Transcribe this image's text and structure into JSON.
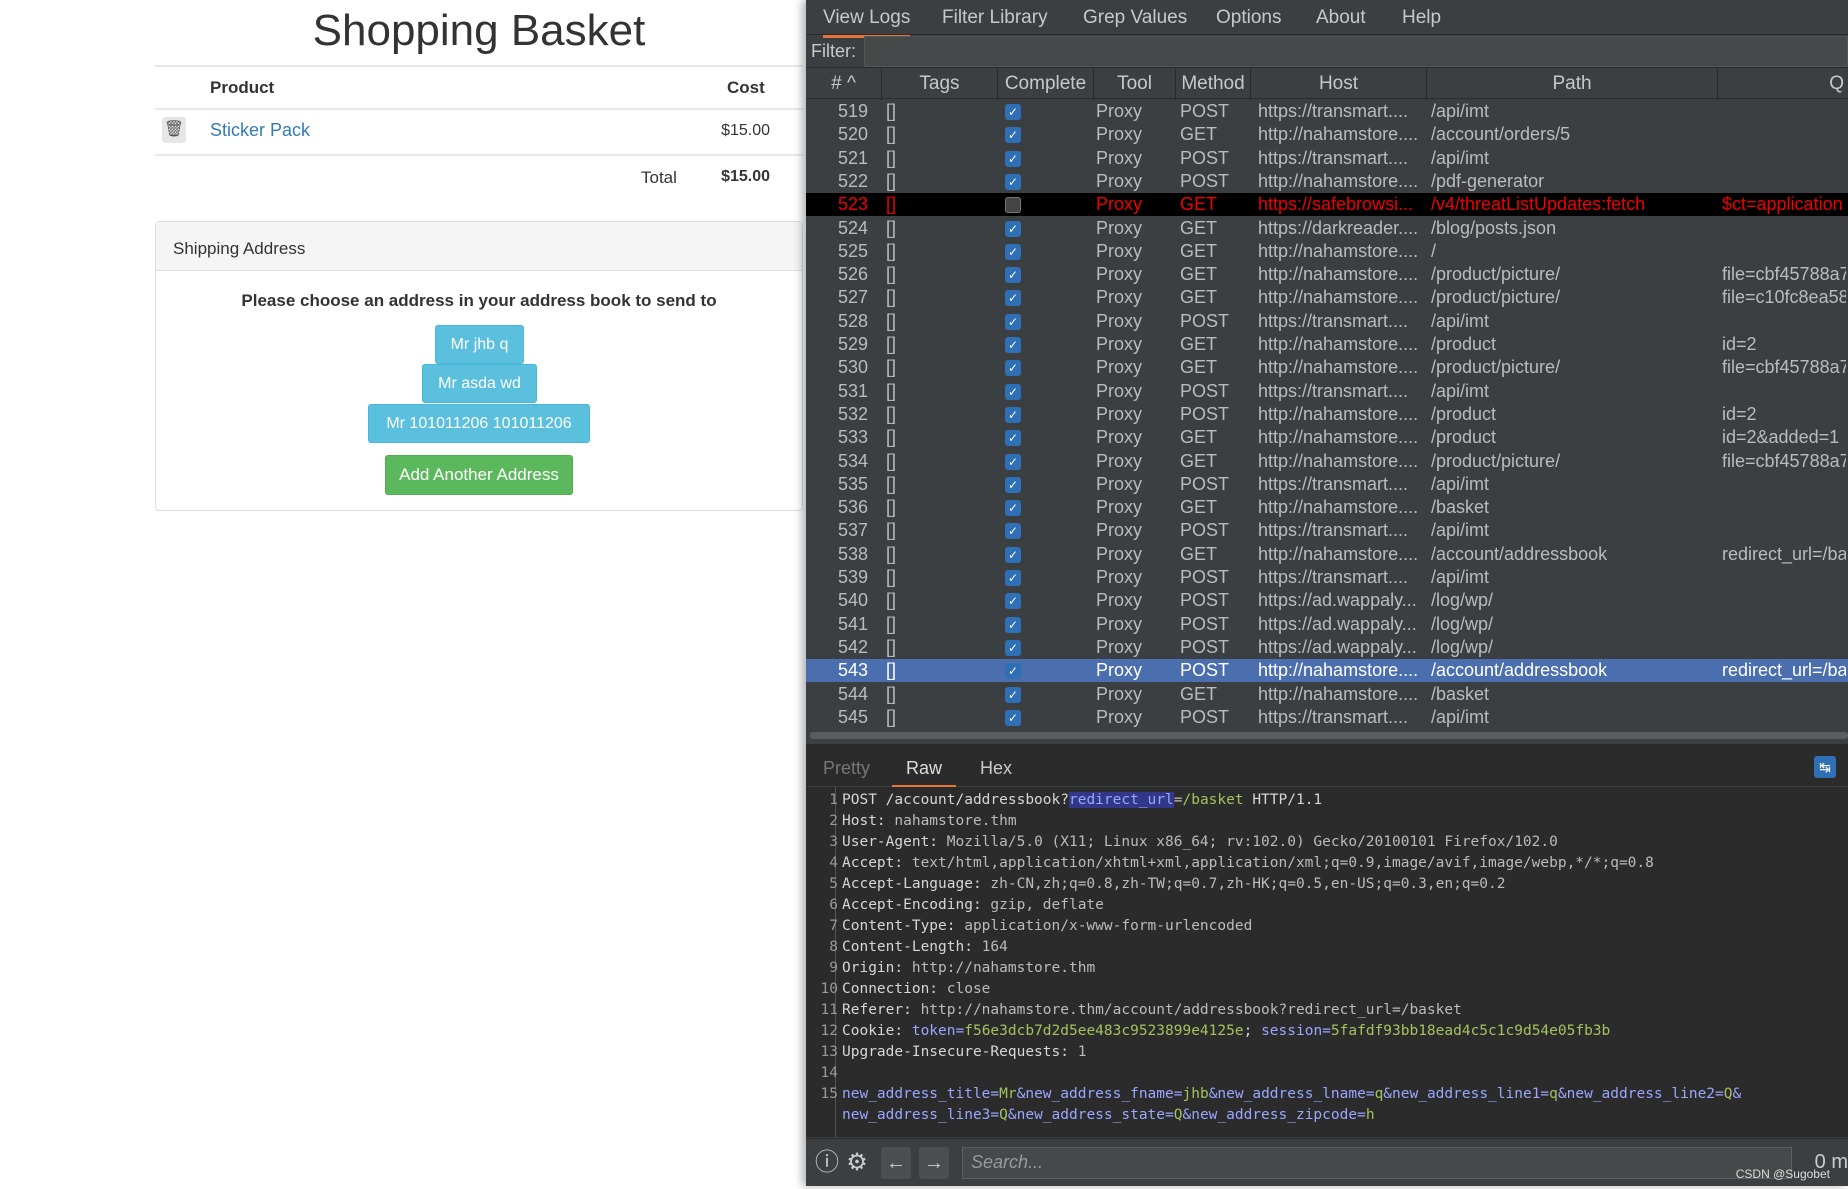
{
  "shop": {
    "title": "Shopping Basket",
    "col_product": "Product",
    "col_cost": "Cost",
    "item": {
      "name": "Sticker Pack",
      "cost": "$15.00"
    },
    "total_label": "Total",
    "total_value": "$15.00",
    "shipping": {
      "header": "Shipping Address",
      "message": "Please choose an address in your address book to send to",
      "addresses": [
        "Mr jhb q",
        "Mr asda wd",
        "Mr 101011206 101011206"
      ],
      "add_button": "Add Another Address"
    }
  },
  "burp": {
    "menu": [
      "View Logs",
      "Filter Library",
      "Grep Values",
      "Options",
      "About",
      "Help"
    ],
    "filter_label": "Filter:",
    "columns": [
      "# ^",
      "Tags",
      "Complete",
      "Tool",
      "Method",
      "Host",
      "Path",
      "Q"
    ],
    "rows": [
      [
        "519",
        "[]",
        true,
        "Proxy",
        "POST",
        "https://transmart....",
        "/api/imt",
        ""
      ],
      [
        "520",
        "[]",
        true,
        "Proxy",
        "GET",
        "http://nahamstore....",
        "/account/orders/5",
        ""
      ],
      [
        "521",
        "[]",
        true,
        "Proxy",
        "POST",
        "https://transmart....",
        "/api/imt",
        ""
      ],
      [
        "522",
        "[]",
        true,
        "Proxy",
        "POST",
        "http://nahamstore....",
        "/pdf-generator",
        ""
      ],
      [
        "523",
        "[]",
        false,
        "Proxy",
        "GET",
        "https://safebrowsi...",
        "/v4/threatListUpdates:fetch",
        "$ct=application"
      ],
      [
        "524",
        "[]",
        true,
        "Proxy",
        "GET",
        "https://darkreader....",
        "/blog/posts.json",
        ""
      ],
      [
        "525",
        "[]",
        true,
        "Proxy",
        "GET",
        "http://nahamstore....",
        "/",
        ""
      ],
      [
        "526",
        "[]",
        true,
        "Proxy",
        "GET",
        "http://nahamstore....",
        "/product/picture/",
        "file=cbf45788a7"
      ],
      [
        "527",
        "[]",
        true,
        "Proxy",
        "GET",
        "http://nahamstore....",
        "/product/picture/",
        "file=c10fc8ea58"
      ],
      [
        "528",
        "[]",
        true,
        "Proxy",
        "POST",
        "https://transmart....",
        "/api/imt",
        ""
      ],
      [
        "529",
        "[]",
        true,
        "Proxy",
        "GET",
        "http://nahamstore....",
        "/product",
        "id=2"
      ],
      [
        "530",
        "[]",
        true,
        "Proxy",
        "GET",
        "http://nahamstore....",
        "/product/picture/",
        "file=cbf45788a7"
      ],
      [
        "531",
        "[]",
        true,
        "Proxy",
        "POST",
        "https://transmart....",
        "/api/imt",
        ""
      ],
      [
        "532",
        "[]",
        true,
        "Proxy",
        "POST",
        "http://nahamstore....",
        "/product",
        "id=2"
      ],
      [
        "533",
        "[]",
        true,
        "Proxy",
        "GET",
        "http://nahamstore....",
        "/product",
        "id=2&added=1"
      ],
      [
        "534",
        "[]",
        true,
        "Proxy",
        "GET",
        "http://nahamstore....",
        "/product/picture/",
        "file=cbf45788a7"
      ],
      [
        "535",
        "[]",
        true,
        "Proxy",
        "POST",
        "https://transmart....",
        "/api/imt",
        ""
      ],
      [
        "536",
        "[]",
        true,
        "Proxy",
        "GET",
        "http://nahamstore....",
        "/basket",
        ""
      ],
      [
        "537",
        "[]",
        true,
        "Proxy",
        "POST",
        "https://transmart....",
        "/api/imt",
        ""
      ],
      [
        "538",
        "[]",
        true,
        "Proxy",
        "GET",
        "http://nahamstore....",
        "/account/addressbook",
        "redirect_url=/ba"
      ],
      [
        "539",
        "[]",
        true,
        "Proxy",
        "POST",
        "https://transmart....",
        "/api/imt",
        ""
      ],
      [
        "540",
        "[]",
        true,
        "Proxy",
        "POST",
        "https://ad.wappaly...",
        "/log/wp/",
        ""
      ],
      [
        "541",
        "[]",
        true,
        "Proxy",
        "POST",
        "https://ad.wappaly...",
        "/log/wp/",
        ""
      ],
      [
        "542",
        "[]",
        true,
        "Proxy",
        "POST",
        "https://ad.wappaly...",
        "/log/wp/",
        ""
      ],
      [
        "543",
        "[]",
        true,
        "Proxy",
        "POST",
        "http://nahamstore....",
        "/account/addressbook",
        "redirect_url=/ba"
      ],
      [
        "544",
        "[]",
        true,
        "Proxy",
        "GET",
        "http://nahamstore....",
        "/basket",
        ""
      ],
      [
        "545",
        "[]",
        true,
        "Proxy",
        "POST",
        "https://transmart....",
        "/api/imt",
        ""
      ]
    ],
    "highlight_row": "523",
    "selected_row": "543",
    "tabs": [
      "Pretty",
      "Raw",
      "Hex"
    ],
    "active_tab": "Raw",
    "request_lines": [
      [
        [
          "k",
          "POST /account/addressbook?"
        ],
        [
          "hl",
          "redirect_url"
        ],
        [
          "v",
          "="
        ],
        [
          "g",
          "/basket"
        ],
        [
          "k",
          " HTTP/1.1"
        ]
      ],
      [
        [
          "k",
          "Host: "
        ],
        [
          "v",
          "nahamstore.thm"
        ]
      ],
      [
        [
          "k",
          "User-Agent: "
        ],
        [
          "v",
          "Mozilla/5.0 (X11; Linux x86_64; rv:102.0) Gecko/20100101 Firefox/102.0"
        ]
      ],
      [
        [
          "k",
          "Accept: "
        ],
        [
          "v",
          "text/html,application/xhtml+xml,application/xml;q=0.9,image/avif,image/webp,*/*;q=0.8"
        ]
      ],
      [
        [
          "k",
          "Accept-Language: "
        ],
        [
          "v",
          "zh-CN,zh;q=0.8,zh-TW;q=0.7,zh-HK;q=0.5,en-US;q=0.3,en;q=0.2"
        ]
      ],
      [
        [
          "k",
          "Accept-Encoding: "
        ],
        [
          "v",
          "gzip, deflate"
        ]
      ],
      [
        [
          "k",
          "Content-Type: "
        ],
        [
          "v",
          "application/x-www-form-urlencoded"
        ]
      ],
      [
        [
          "k",
          "Content-Length: "
        ],
        [
          "v",
          "164"
        ]
      ],
      [
        [
          "k",
          "Origin: "
        ],
        [
          "v",
          "http://nahamstore.thm"
        ]
      ],
      [
        [
          "k",
          "Connection: "
        ],
        [
          "v",
          "close"
        ]
      ],
      [
        [
          "k",
          "Referer: "
        ],
        [
          "v",
          "http://nahamstore.thm/account/addressbook?redirect_url=/basket"
        ]
      ],
      [
        [
          "k",
          "Cookie: "
        ],
        [
          "u",
          "token="
        ],
        [
          "g",
          "f56e3dcb7d2d5ee483c9523899e4125e"
        ],
        [
          "k",
          "; "
        ],
        [
          "u",
          "session="
        ],
        [
          "g",
          "5fafdf93bb18ead4c5c1c9d54e05fb3b"
        ]
      ],
      [
        [
          "k",
          "Upgrade-Insecure-Requests: "
        ],
        [
          "v",
          "1"
        ]
      ],
      [],
      [
        [
          "u",
          "new_address_title="
        ],
        [
          "g",
          "Mr"
        ],
        [
          "u",
          "&new_address_fname="
        ],
        [
          "g",
          "jhb"
        ],
        [
          "u",
          "&new_address_lname="
        ],
        [
          "g",
          "q"
        ],
        [
          "u",
          "&new_address_line1="
        ],
        [
          "g",
          "q"
        ],
        [
          "u",
          "&new_address_line2="
        ],
        [
          "g",
          "Q"
        ],
        [
          "u",
          "&"
        ]
      ],
      [
        [
          "u",
          "new_address_line3="
        ],
        [
          "g",
          "Q"
        ],
        [
          "u",
          "&new_address_state="
        ],
        [
          "g",
          "Q"
        ],
        [
          "u",
          "&new_address_zipcode="
        ],
        [
          "g",
          "h"
        ]
      ]
    ],
    "search_placeholder": "Search...",
    "match_count": "0 m",
    "watermark": "CSDN @Sugobet"
  }
}
